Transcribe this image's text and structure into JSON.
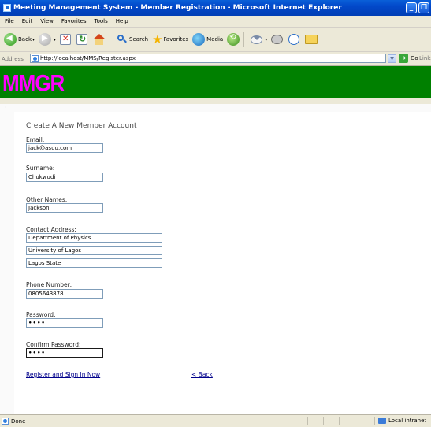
{
  "window": {
    "title": "Meeting Management System - Member Registration - Microsoft Internet Explorer",
    "minimize_glyph": "_",
    "restore_glyph": "❐"
  },
  "menu": {
    "items": [
      {
        "key": "F",
        "rest": "ile"
      },
      {
        "key": "E",
        "rest": "dit"
      },
      {
        "key": "V",
        "rest": "iew"
      },
      {
        "key": "Favorites",
        "rest": ""
      },
      {
        "key": "T",
        "rest": "ools"
      },
      {
        "key": "H",
        "rest": "elp"
      }
    ],
    "file": "File",
    "edit": "Edit",
    "view": "View",
    "favorites": "Favorites",
    "tools": "Tools",
    "help": "Help"
  },
  "toolbar": {
    "back": "Back",
    "search": "Search",
    "favorites": "Favorites",
    "media": "Media"
  },
  "address": {
    "label": "Address",
    "url": "http://localhost/MMS/Register.aspx",
    "go": "Go",
    "links": "Links"
  },
  "page": {
    "logo": "MMGR",
    "dot": "·",
    "form_title": "Create A New Member Account",
    "email_label": "Email:",
    "email_value": "jack@asuu.com",
    "surname_label": "Surname:",
    "surname_value": "Chukwudi",
    "other_names_label": "Other Names:",
    "other_names_value": "Jackson",
    "address_label": "Contact Address:",
    "address_line1": "Department of Physics",
    "address_line2": "University of Lagos",
    "address_line3": "Lagos State",
    "phone_label": "Phone Number:",
    "phone_value": "0805643878",
    "password_label": "Password:",
    "password_mask": "••••",
    "confirm_label": "Confirm Password:",
    "confirm_mask": "••••",
    "register_link": "Register and Sign In Now",
    "back_link": "< Back"
  },
  "status": {
    "text": "Done",
    "zone": "Local intranet"
  },
  "colors": {
    "banner": "#008000",
    "logo": "#ff00ff",
    "link": "#00008b"
  }
}
